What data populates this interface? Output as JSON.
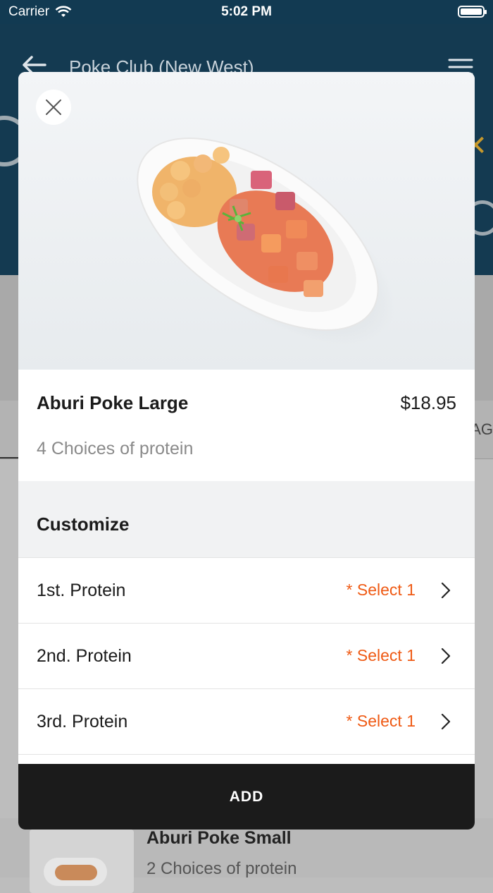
{
  "status_bar": {
    "carrier": "Carrier",
    "time": "5:02 PM"
  },
  "nav": {
    "title": "Poke Club (New West)"
  },
  "background": {
    "tab_partial": "AG",
    "item": {
      "name": "Aburi Poke Small",
      "description": "2 Choices of protein"
    }
  },
  "modal": {
    "item": {
      "name": "Aburi Poke Large",
      "price": "$18.95",
      "description": "4 Choices of protein"
    },
    "section_title": "Customize",
    "options": [
      {
        "label": "1st. Protein",
        "requirement": "* Select 1"
      },
      {
        "label": "2nd. Protein",
        "requirement": "* Select 1"
      },
      {
        "label": "3rd. Protein",
        "requirement": "* Select 1"
      }
    ],
    "add_label": "ADD"
  },
  "colors": {
    "accent": "#ef5a14",
    "header": "#143a51",
    "button": "#1b1b1b"
  },
  "icons": [
    "wifi-icon",
    "battery-icon",
    "back-arrow-icon",
    "menu-icon",
    "close-icon",
    "chevron-right-icon"
  ]
}
